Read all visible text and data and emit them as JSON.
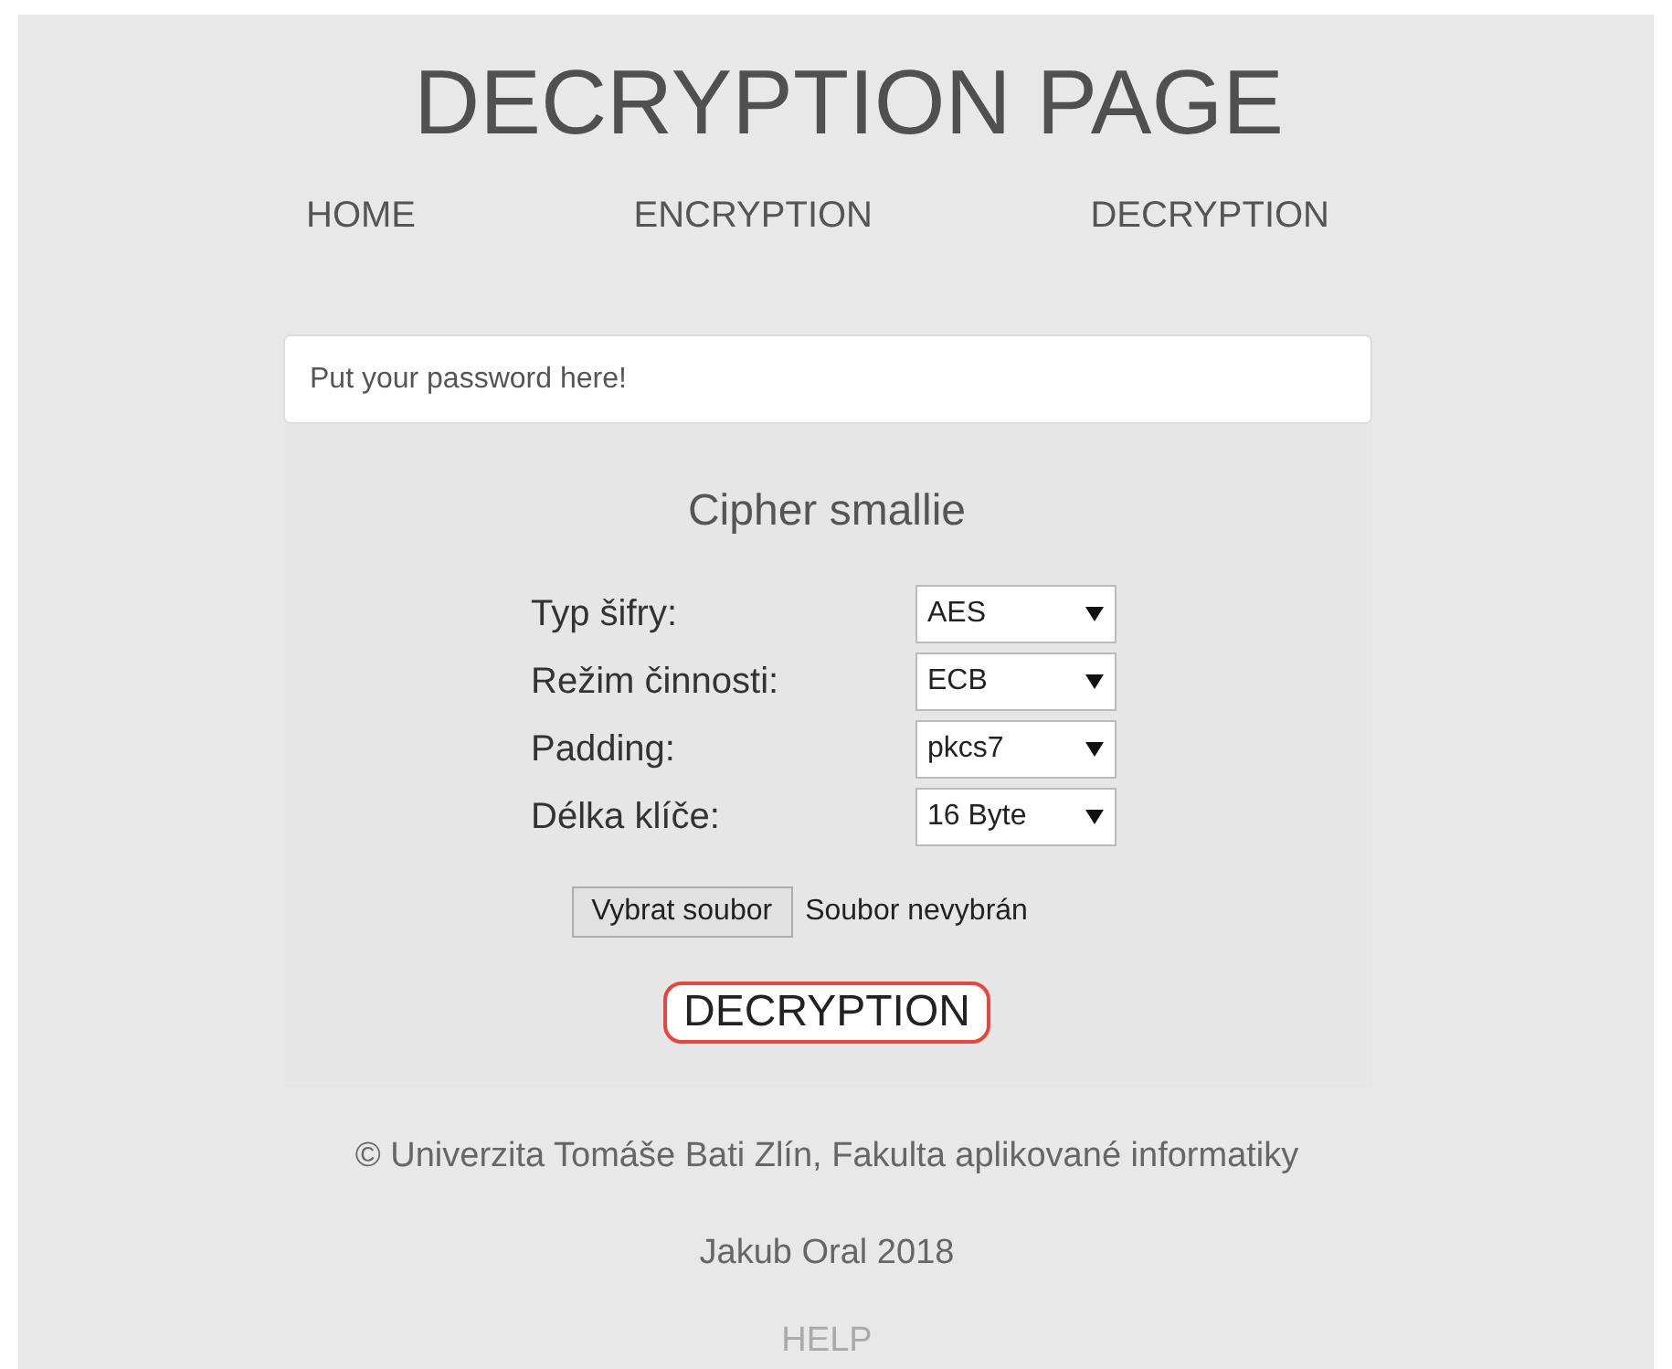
{
  "title": "DECRYPTION PAGE",
  "nav": [
    "HOME",
    "ENCRYPTION",
    "DECRYPTION"
  ],
  "password": {
    "placeholder": "Put your password here!"
  },
  "panel": {
    "heading": "Cipher smallie",
    "fields": [
      {
        "label": "Typ šifry:",
        "value": "AES"
      },
      {
        "label": "Režim činnosti:",
        "value": "ECB"
      },
      {
        "label": "Padding:",
        "value": "pkcs7"
      },
      {
        "label": "Délka klíče:",
        "value": "16 Byte"
      }
    ],
    "file": {
      "button": "Vybrat soubor",
      "status": "Soubor nevybrán"
    },
    "submit": "DECRYPTION"
  },
  "footer": {
    "copyright": "© Univerzita Tomáše Bati Zlín, Fakulta aplikované informatiky",
    "author": "Jakub Oral 2018",
    "help": "HELP"
  }
}
